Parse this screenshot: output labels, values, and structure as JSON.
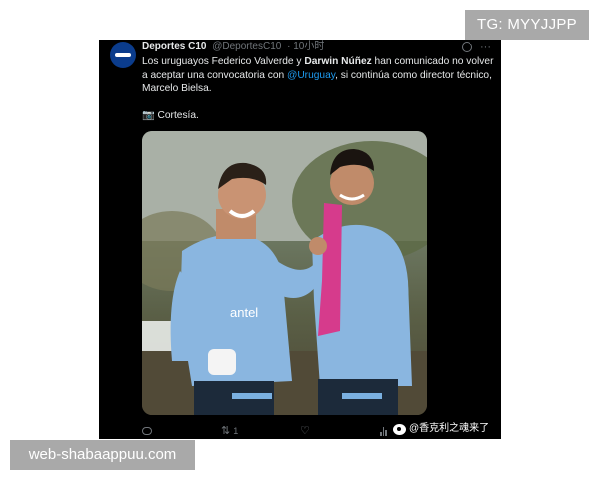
{
  "watermarks": {
    "top": "TG: MYYJJPP",
    "bottom": "web-shabaappuu.com"
  },
  "tweet": {
    "author_name": "Deportes C10",
    "handle": "@DeportesC10",
    "time": "· 10小时",
    "text": {
      "part1": "Los uruguayos Federico Valverde y ",
      "bold_name": "Darwin Núñez",
      "part2": " han comunicado no volver a aceptar una convocatoria con ",
      "mention": "@Uruguay",
      "part3": ", si continúa como director técnico, Marcelo Bielsa."
    },
    "courtesy_icon": "📷",
    "courtesy": "Cortesía.",
    "photo_alt_subject": "two-players-photo",
    "actions": {
      "reply_count": "",
      "retweet_count": "1",
      "like_count": ""
    }
  },
  "weibo_credit": "@香克利之魂来了",
  "icons": {
    "more": "more-icon",
    "grok": "grok-icon",
    "reply": "reply-icon",
    "retweet": "retweet-icon",
    "like": "like-icon",
    "views": "views-icon",
    "weibo": "weibo-icon"
  },
  "colors": {
    "background": "#000000",
    "text": "#e7e9ea",
    "muted": "#71767b",
    "link": "#1d9bf0",
    "watermark": "#a9a9a9"
  }
}
